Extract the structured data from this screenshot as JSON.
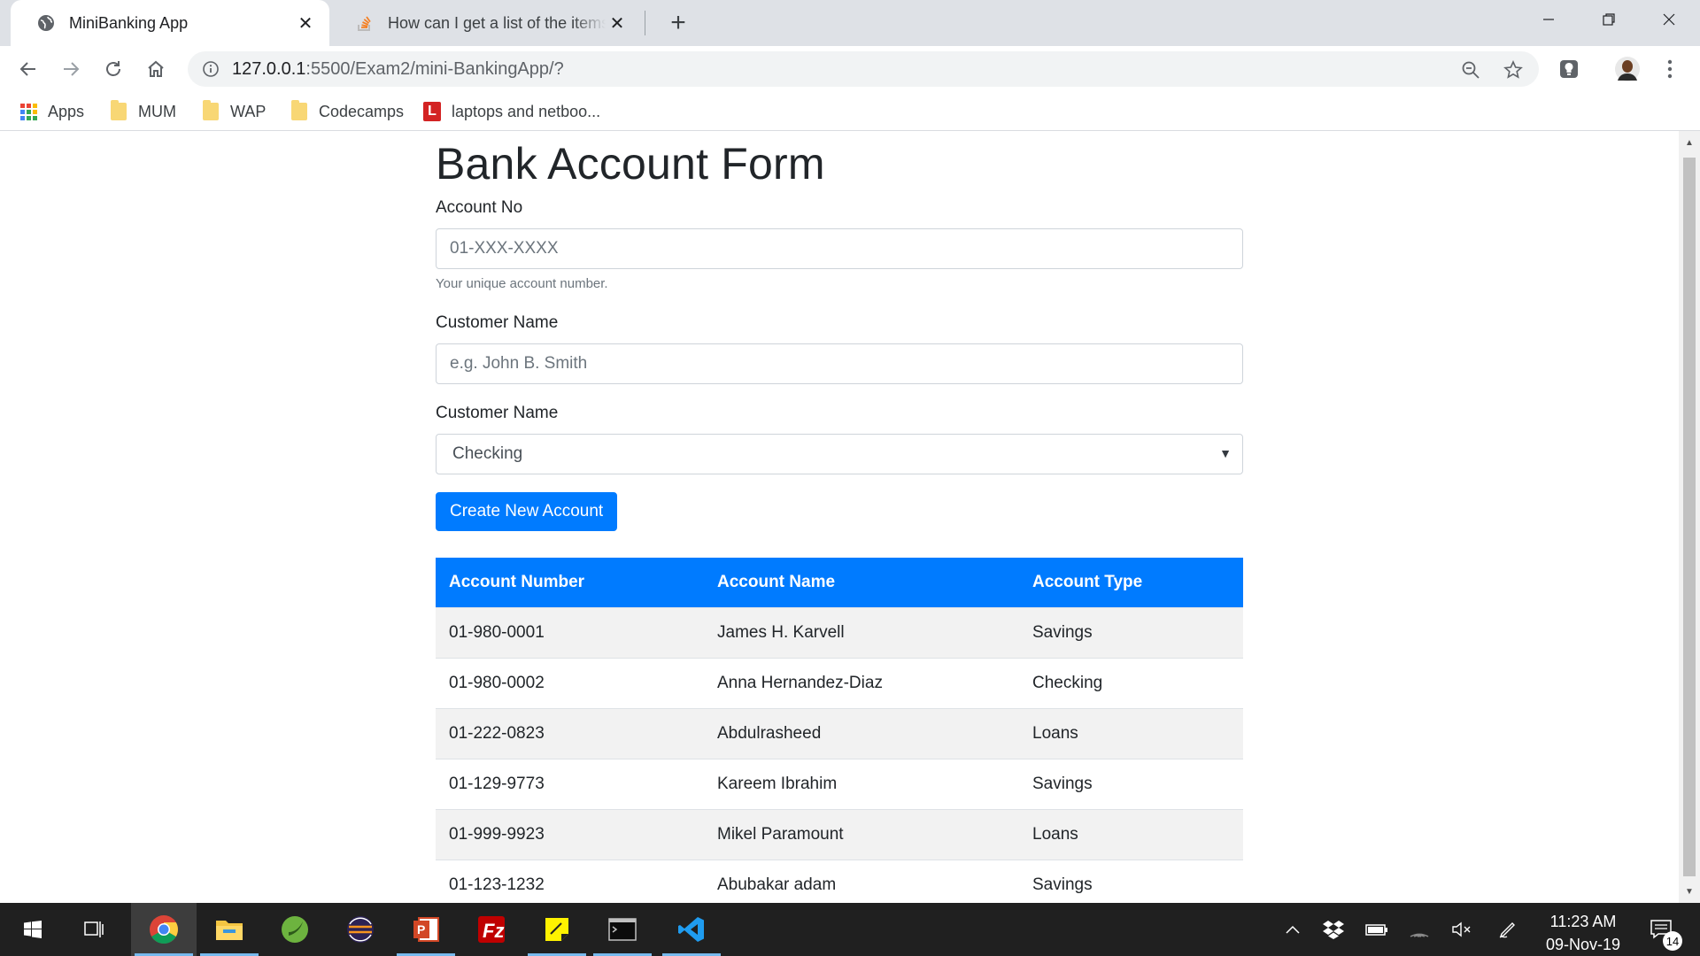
{
  "browser": {
    "tabs": [
      {
        "title": "MiniBanking App",
        "active": true,
        "favicon": "globe-icon"
      },
      {
        "title": "How can I get a list of the items s",
        "active": false,
        "favicon": "stackoverflow-icon"
      }
    ],
    "address_bar": {
      "host": "127.0.0.1",
      "path": ":5500/Exam2/mini-BankingApp/?"
    },
    "bookmarks": [
      {
        "label": "Apps",
        "icon": "apps-grid-icon"
      },
      {
        "label": "MUM",
        "icon": "folder-icon"
      },
      {
        "label": "WAP",
        "icon": "folder-icon"
      },
      {
        "label": "Codecamps",
        "icon": "folder-icon"
      },
      {
        "label": "laptops and netboo...",
        "icon": "l-badge-icon"
      }
    ]
  },
  "form": {
    "title": "Bank Account Form",
    "account_no": {
      "label": "Account No",
      "placeholder": "01-XXX-XXXX",
      "value": "",
      "help": "Your unique account number."
    },
    "customer_name": {
      "label": "Customer Name",
      "placeholder": "e.g. John B. Smith",
      "value": ""
    },
    "account_type": {
      "label": "Customer Name",
      "selected": "Checking"
    },
    "submit_label": "Create New Account"
  },
  "accounts_table": {
    "headers": [
      "Account Number",
      "Account Name",
      "Account Type"
    ],
    "rows": [
      [
        "01-980-0001",
        "James H. Karvell",
        "Savings"
      ],
      [
        "01-980-0002",
        "Anna Hernandez-Diaz",
        "Checking"
      ],
      [
        "01-222-0823",
        "Abdulrasheed",
        "Loans"
      ],
      [
        "01-129-9773",
        "Kareem Ibrahim",
        "Savings"
      ],
      [
        "01-999-9923",
        "Mikel Paramount",
        "Loans"
      ],
      [
        "01-123-1232",
        "Abubakar adam",
        "Savings"
      ]
    ]
  },
  "taskbar": {
    "time": "11:23 AM",
    "date": "09-Nov-19",
    "notification_count": "14",
    "apps": [
      "start-icon",
      "task-view-icon",
      "chrome-icon",
      "file-explorer-icon",
      "spring-tools-icon",
      "eclipse-icon",
      "powerpoint-icon",
      "filezilla-icon",
      "sticky-notes-icon",
      "terminal-icon",
      "vscode-icon"
    ]
  },
  "colors": {
    "primary": "#007bff",
    "stripe": "#f2f2f2",
    "taskbar": "#202020",
    "tabstrip": "#dee1e6"
  }
}
